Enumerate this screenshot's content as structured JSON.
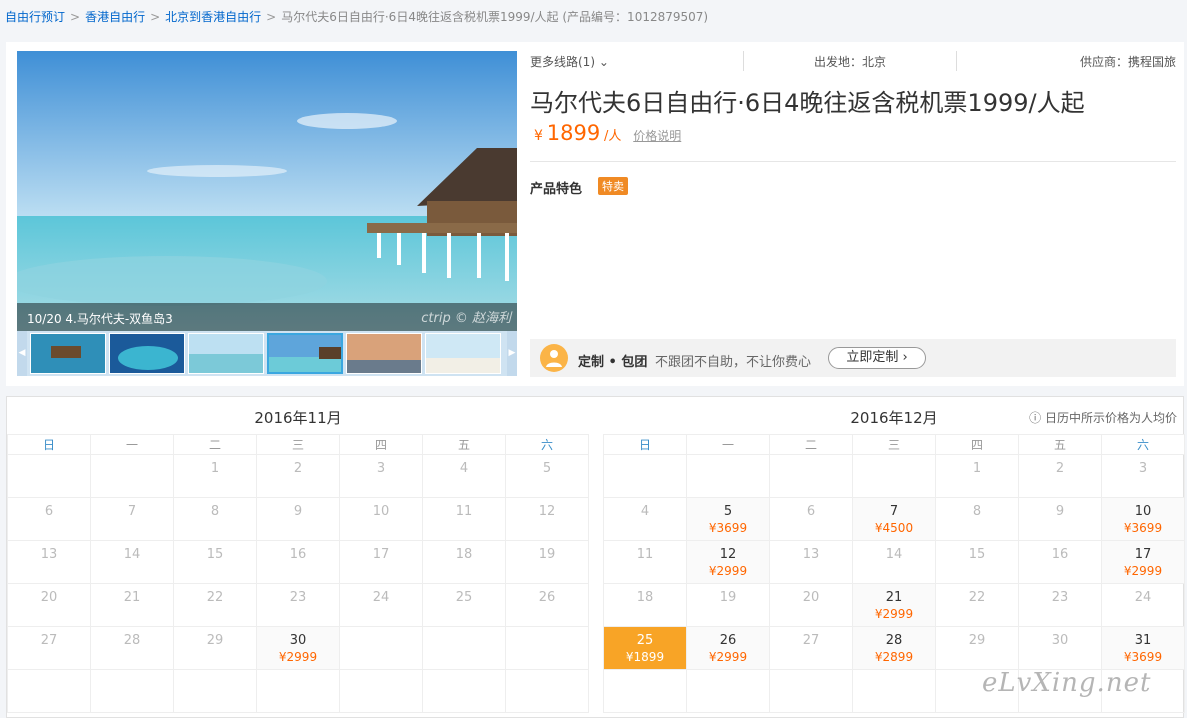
{
  "breadcrumb": {
    "items": [
      "自由行预订",
      "香港自由行",
      "北京到香港自由行"
    ],
    "separator": ">",
    "current": "马尔代夫6日自由行·6日4晚往返含税机票1999/人起",
    "product_code": "(产品编号：1012879507)"
  },
  "gallery": {
    "caption": "10/20 4.马尔代夫-双鱼岛3",
    "watermark": "ctrip © 赵海利",
    "thumbnails": [
      "thumb-1",
      "thumb-2",
      "thumb-3",
      "thumb-4",
      "thumb-5",
      "thumb-6"
    ],
    "prev_icon": "◀",
    "next_icon": "▶"
  },
  "product": {
    "more_routes": "更多线路(1)",
    "departure": "出发地：北京",
    "supplier": "供应商：携程国旅",
    "title": "马尔代夫6日自由行·6日4晚往返含税机票1999/人起",
    "currency": "¥",
    "price": "1899",
    "price_unit": "/人",
    "price_note": "价格说明",
    "feature_label": "产品特色",
    "feature_tag": "特卖"
  },
  "custom_banner": {
    "title": "定制 • 包团",
    "text": "不跟团不自助，不让你费心",
    "button": "立即定制 ›"
  },
  "calendar": {
    "legend": "ⓘ 日历中所示价格为人均价",
    "weekdays": [
      "日",
      "一",
      "二",
      "三",
      "四",
      "五",
      "六"
    ],
    "months": [
      {
        "title": "2016年11月",
        "weeks": [
          [
            {
              "d": ""
            },
            {
              "d": ""
            },
            {
              "d": "1"
            },
            {
              "d": "2"
            },
            {
              "d": "3"
            },
            {
              "d": "4"
            },
            {
              "d": "5"
            }
          ],
          [
            {
              "d": "6"
            },
            {
              "d": "7"
            },
            {
              "d": "8"
            },
            {
              "d": "9"
            },
            {
              "d": "10"
            },
            {
              "d": "11"
            },
            {
              "d": "12"
            }
          ],
          [
            {
              "d": "13"
            },
            {
              "d": "14"
            },
            {
              "d": "15"
            },
            {
              "d": "16"
            },
            {
              "d": "17"
            },
            {
              "d": "18"
            },
            {
              "d": "19"
            }
          ],
          [
            {
              "d": "20"
            },
            {
              "d": "21"
            },
            {
              "d": "22"
            },
            {
              "d": "23"
            },
            {
              "d": "24"
            },
            {
              "d": "25"
            },
            {
              "d": "26"
            }
          ],
          [
            {
              "d": "27"
            },
            {
              "d": "28"
            },
            {
              "d": "29"
            },
            {
              "d": "30",
              "p": "¥2999"
            },
            {
              "d": ""
            },
            {
              "d": ""
            },
            {
              "d": ""
            }
          ],
          [
            {
              "d": ""
            },
            {
              "d": ""
            },
            {
              "d": ""
            },
            {
              "d": ""
            },
            {
              "d": ""
            },
            {
              "d": ""
            },
            {
              "d": ""
            }
          ]
        ]
      },
      {
        "title": "2016年12月",
        "weeks": [
          [
            {
              "d": ""
            },
            {
              "d": ""
            },
            {
              "d": ""
            },
            {
              "d": ""
            },
            {
              "d": "1"
            },
            {
              "d": "2"
            },
            {
              "d": "3"
            }
          ],
          [
            {
              "d": "4"
            },
            {
              "d": "5",
              "p": "¥3699"
            },
            {
              "d": "6"
            },
            {
              "d": "7",
              "p": "¥4500"
            },
            {
              "d": "8"
            },
            {
              "d": "9"
            },
            {
              "d": "10",
              "p": "¥3699"
            }
          ],
          [
            {
              "d": "11"
            },
            {
              "d": "12",
              "p": "¥2999"
            },
            {
              "d": "13"
            },
            {
              "d": "14"
            },
            {
              "d": "15"
            },
            {
              "d": "16"
            },
            {
              "d": "17",
              "p": "¥2999"
            }
          ],
          [
            {
              "d": "18"
            },
            {
              "d": "19"
            },
            {
              "d": "20"
            },
            {
              "d": "21",
              "p": "¥2999"
            },
            {
              "d": "22"
            },
            {
              "d": "23"
            },
            {
              "d": "24"
            }
          ],
          [
            {
              "d": "25",
              "p": "¥1899",
              "sel": true
            },
            {
              "d": "26",
              "p": "¥2999"
            },
            {
              "d": "27"
            },
            {
              "d": "28",
              "p": "¥2899"
            },
            {
              "d": "29"
            },
            {
              "d": "30"
            },
            {
              "d": "31",
              "p": "¥3699"
            }
          ],
          [
            {
              "d": ""
            },
            {
              "d": ""
            },
            {
              "d": ""
            },
            {
              "d": ""
            },
            {
              "d": ""
            },
            {
              "d": ""
            },
            {
              "d": ""
            }
          ]
        ]
      }
    ]
  },
  "site_watermark": "eLvXing.net"
}
